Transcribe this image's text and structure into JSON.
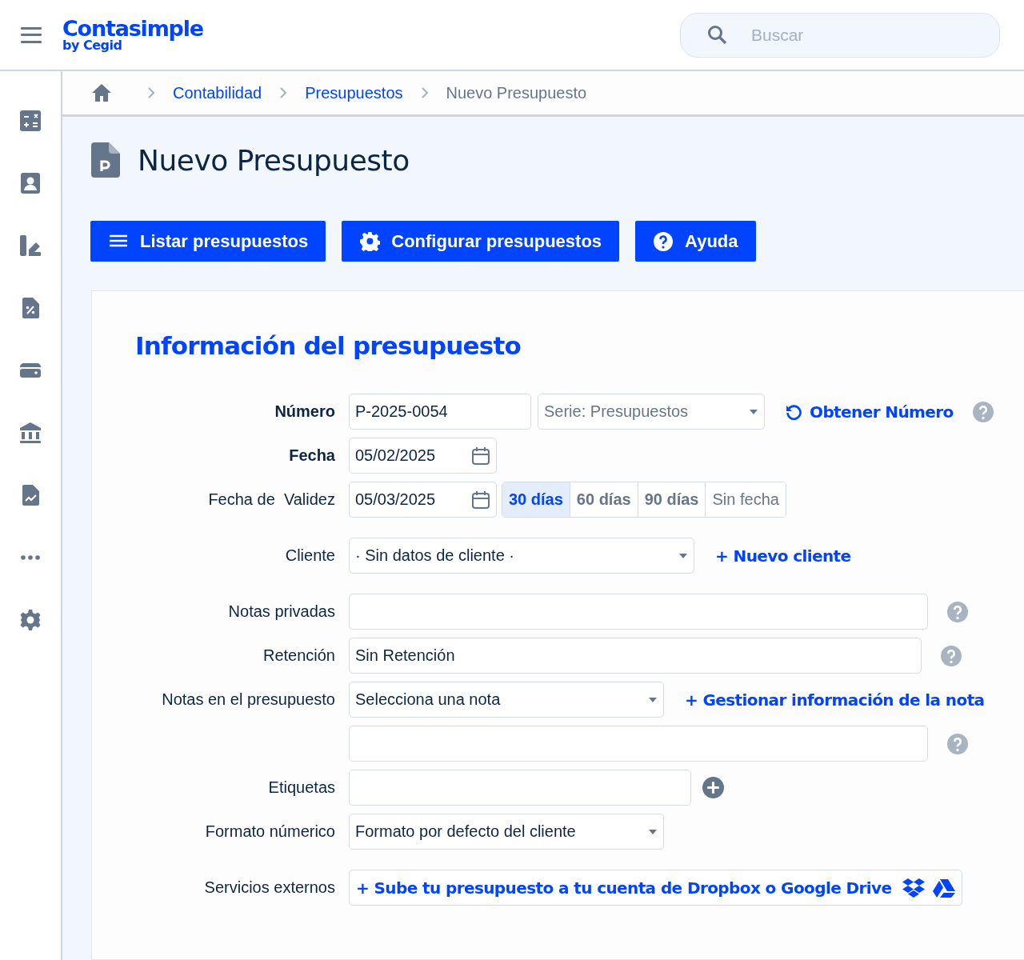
{
  "header": {
    "logo": "Contasimple",
    "byline": "by Cegid",
    "search": {
      "placeholder": "Buscar"
    }
  },
  "breadcrumb": [
    {
      "label": "Contabilidad",
      "kind": "link"
    },
    {
      "label": "Presupuestos",
      "kind": "link"
    },
    {
      "label": "Nuevo Presupuesto",
      "kind": "current"
    }
  ],
  "page_title": "Nuevo Presupuesto",
  "actions": [
    {
      "label": "Listar presupuestos"
    },
    {
      "label": "Configurar presupuestos"
    },
    {
      "label": "Ayuda"
    }
  ],
  "form": {
    "title": "Información del presupuesto",
    "rows": [
      {
        "label": "Número",
        "required": true,
        "controls": [
          {
            "kind": "input",
            "value": "P-2025-0054"
          },
          {
            "kind": "select",
            "placeholder": "Serie: Presupuestos"
          },
          {
            "kind": "refresh",
            "label": "Obtener Número"
          },
          {
            "kind": "help"
          }
        ]
      },
      {
        "label": "Fecha",
        "required": true,
        "controls": [
          {
            "kind": "date",
            "value": "05/02/2025"
          }
        ]
      },
      {
        "label": "Fecha de  Validez",
        "required": false,
        "controls": [
          {
            "kind": "date",
            "value": "05/03/2025"
          },
          {
            "kind": "segments",
            "options": [
              {
                "label": "30 días",
                "selected": true,
                "kind": "days"
              },
              {
                "label": "60 días",
                "selected": false,
                "kind": "days"
              },
              {
                "label": "90 días",
                "selected": false,
                "kind": "days"
              },
              {
                "label": "Sin fecha",
                "selected": false,
                "kind": "none"
              }
            ]
          }
        ]
      },
      {
        "label": "Cliente",
        "required": false,
        "controls": [
          {
            "kind": "select",
            "value": "· Sin datos de cliente ·"
          },
          {
            "kind": "link",
            "label": "+ Nuevo cliente"
          }
        ]
      },
      {
        "label": "Notas privadas",
        "required": false,
        "controls": [
          {
            "kind": "input"
          },
          {
            "kind": "help"
          }
        ]
      },
      {
        "label": "Retención",
        "required": false,
        "controls": [
          {
            "kind": "input",
            "value": "Sin Retención"
          },
          {
            "kind": "help"
          }
        ]
      },
      {
        "label": "Notas en el presupuesto",
        "required": false,
        "controls": [
          {
            "kind": "select",
            "value": "Selecciona una nota"
          },
          {
            "kind": "link",
            "label": "+ Gestionar información de la nota"
          }
        ]
      },
      {
        "controls": [
          {
            "kind": "input"
          },
          {
            "kind": "help"
          }
        ]
      },
      {
        "label": "Etiquetas",
        "required": false,
        "controls": [
          {
            "kind": "input"
          },
          {
            "kind": "add"
          }
        ]
      },
      {
        "label": "Formato númerico",
        "required": false,
        "controls": [
          {
            "kind": "select",
            "value": "Formato por defecto del cliente"
          }
        ]
      },
      {
        "label": "Servicios externos",
        "required": false,
        "controls": [
          {
            "kind": "cloud",
            "label": "+ Sube tu presupuesto a tu cuenta de Dropbox o Google Drive"
          }
        ]
      }
    ]
  }
}
